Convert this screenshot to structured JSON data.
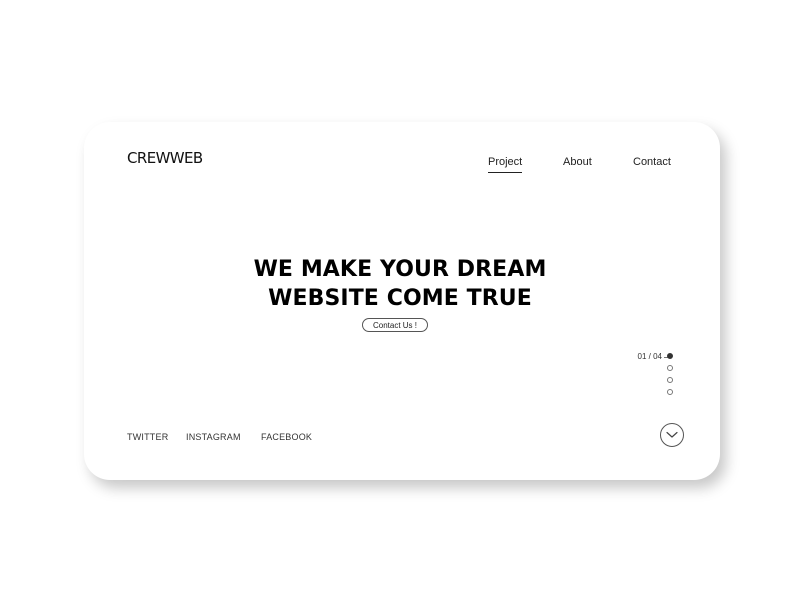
{
  "brand": {
    "logo_text": "CREWWEB"
  },
  "nav": {
    "items": [
      {
        "label": "Project",
        "active": true
      },
      {
        "label": "About",
        "active": false
      },
      {
        "label": "Contact",
        "active": false
      }
    ]
  },
  "hero": {
    "title_line1": "WE MAKE YOUR DREAM",
    "title_line2": "WEBSITE COME TRUE",
    "cta_label": "Contact Us !"
  },
  "pager": {
    "label": "01 / 04",
    "current": 1,
    "total": 4
  },
  "social": {
    "twitter": "TWITTER",
    "instagram": "INSTAGRAM",
    "facebook": "FACEBOOK"
  },
  "scroll": {
    "icon": "chevron-down-icon"
  },
  "colors": {
    "background": "#ffffff",
    "text": "#111111",
    "accent": "#000000"
  }
}
